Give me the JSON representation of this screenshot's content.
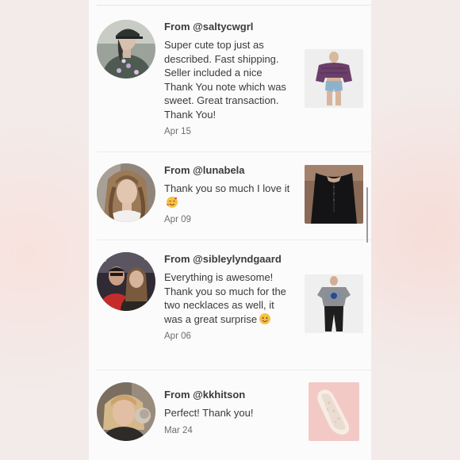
{
  "reviews": [
    {
      "from": "From @saltycwgrl",
      "message": "Super cute top just as described. Fast shipping. Seller included a nice Thank You note which was sweet. Great transaction. Thank You!",
      "date": "Apr 15",
      "item_image": "purple off-shoulder top with denim shorts",
      "avatar": "woman in cap and sequin top"
    },
    {
      "from": "From @lunabela",
      "message": "Thank you so much I love it",
      "emoji": "smiling-face-with-hearts-emoji",
      "date": "Apr 09",
      "item_image": "black long-sleeve bodysuit",
      "avatar": "woman with long wavy hair"
    },
    {
      "from": "From @sibleylyndgaard",
      "message": "Everything is awesome! Thank you so much for the two necklaces as well, it was a great surprise",
      "emoji": "smiling-face-emoji",
      "date": "Apr 06",
      "item_image": "gray NASA t-shirt with black jeans",
      "avatar": "couple at stadium in red"
    },
    {
      "from": "From @kkhitson",
      "message": "Perfect! Thank you!",
      "date": "Mar 24",
      "item_image": "pink lace slip-on shoe",
      "avatar": "woman with blonde hair"
    }
  ]
}
